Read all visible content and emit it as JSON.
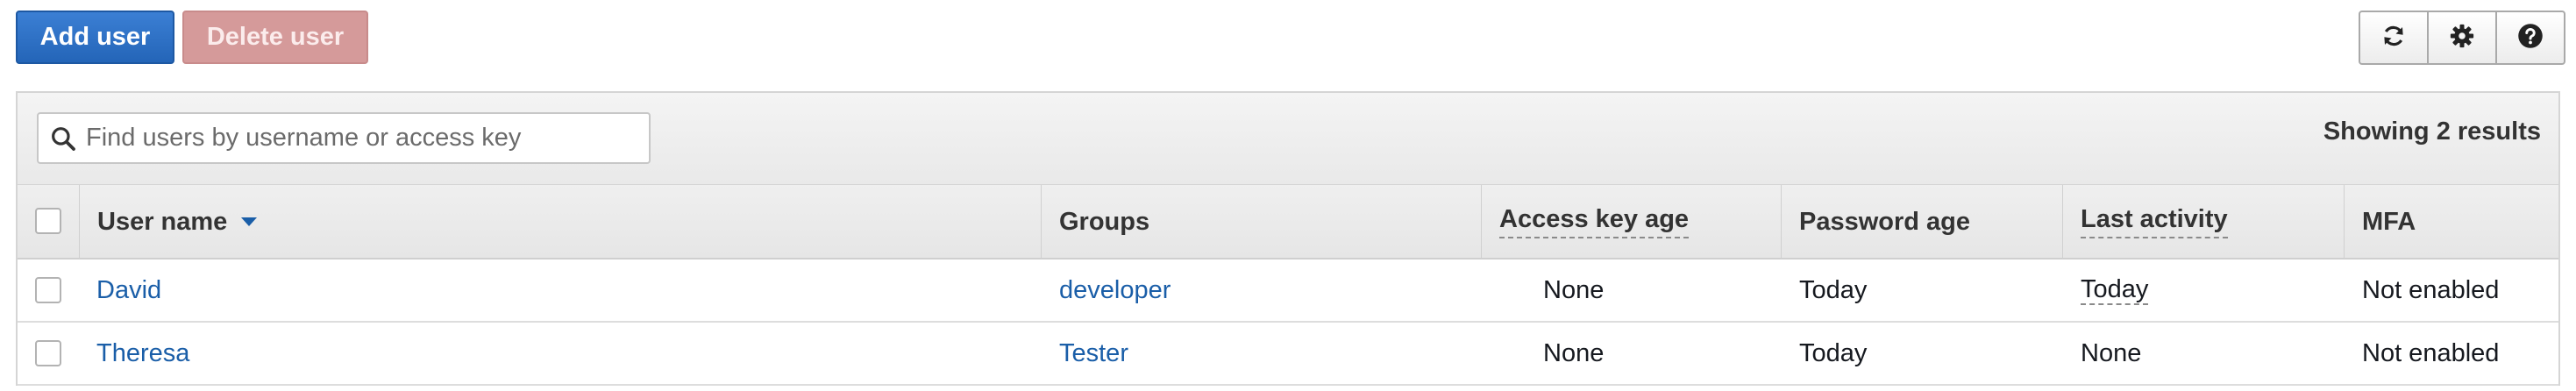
{
  "toolbar": {
    "add_user_label": "Add user",
    "delete_user_label": "Delete user",
    "icons": [
      "refresh-icon",
      "gear-icon",
      "help-icon"
    ]
  },
  "filter": {
    "search_placeholder": "Find users by username or access key",
    "search_value": "",
    "results_text": "Showing 2 results"
  },
  "table": {
    "columns": {
      "user_name": "User name",
      "groups": "Groups",
      "access_key_age": "Access key age",
      "password_age": "Password age",
      "last_activity": "Last activity",
      "mfa": "MFA"
    },
    "sort": {
      "column": "User name",
      "direction": "descending"
    },
    "rows": [
      {
        "user_name": "David",
        "groups": "developer",
        "access_key_age": "None",
        "password_age": "Today",
        "last_activity": "Today",
        "mfa": "Not enabled"
      },
      {
        "user_name": "Theresa",
        "groups": "Tester",
        "access_key_age": "None",
        "password_age": "Today",
        "last_activity": "None",
        "mfa": "Not enabled"
      }
    ]
  },
  "colors": {
    "primary": "#2465b8",
    "disabled_danger": "#d59a9a",
    "link": "#1a5ea8"
  }
}
